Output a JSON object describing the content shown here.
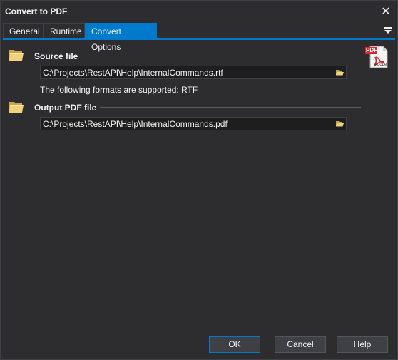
{
  "window": {
    "title": "Convert to PDF"
  },
  "tabs": [
    {
      "label": "General"
    },
    {
      "label": "Runtime"
    },
    {
      "label": "Convert Options"
    }
  ],
  "source": {
    "label": "Source file",
    "value": "C:\\Projects\\RestAPI\\Help\\InternalCommands.rtf",
    "note": "The following formats are supported: RTF"
  },
  "output": {
    "label": "Output PDF file",
    "value": "C:\\Projects\\RestAPI\\Help\\InternalCommands.pdf"
  },
  "pdf_logo": {
    "badge": "PDF",
    "brand": "Adobe"
  },
  "buttons": {
    "ok": "OK",
    "cancel": "Cancel",
    "help": "Help"
  },
  "colors": {
    "accent": "#007acc",
    "background": "#2d2d30",
    "field": "#1e1e1e"
  }
}
